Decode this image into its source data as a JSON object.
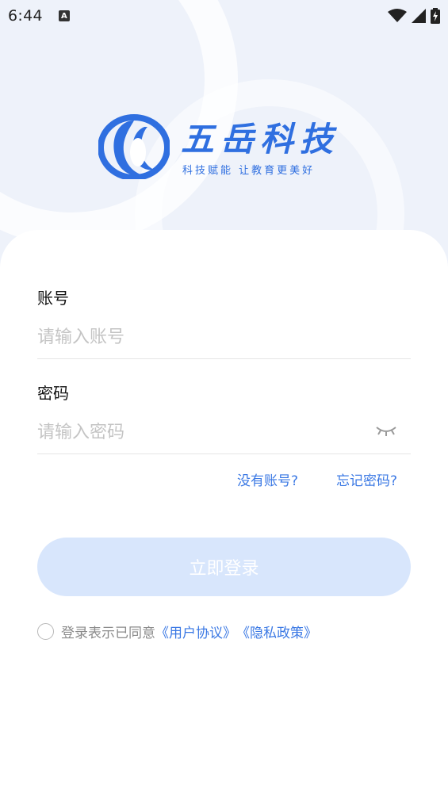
{
  "status_bar": {
    "time": "6:44",
    "notification_icon": "a-icon",
    "icons": [
      "wifi-icon",
      "cellular-icon",
      "battery-charging-icon"
    ]
  },
  "logo": {
    "name": "五岳科技",
    "slogan": "科技赋能 让教育更美好",
    "brand_color": "#2f6fe0"
  },
  "form": {
    "account": {
      "label": "账号",
      "placeholder": "请输入账号",
      "value": ""
    },
    "password": {
      "label": "密码",
      "placeholder": "请输入密码",
      "value": "",
      "toggle_icon": "eye-closed-icon"
    },
    "no_account_link": "没有账号?",
    "forgot_password_link": "忘记密码?",
    "login_button": "立即登录"
  },
  "agreement": {
    "checked": false,
    "text": "登录表示已同意",
    "user_agreement": "《用户协议》",
    "privacy_policy": "《隐私政策》"
  },
  "colors": {
    "accent": "#3a78e4",
    "button_disabled": "#d8e6fc",
    "background": "#eef2fa"
  }
}
